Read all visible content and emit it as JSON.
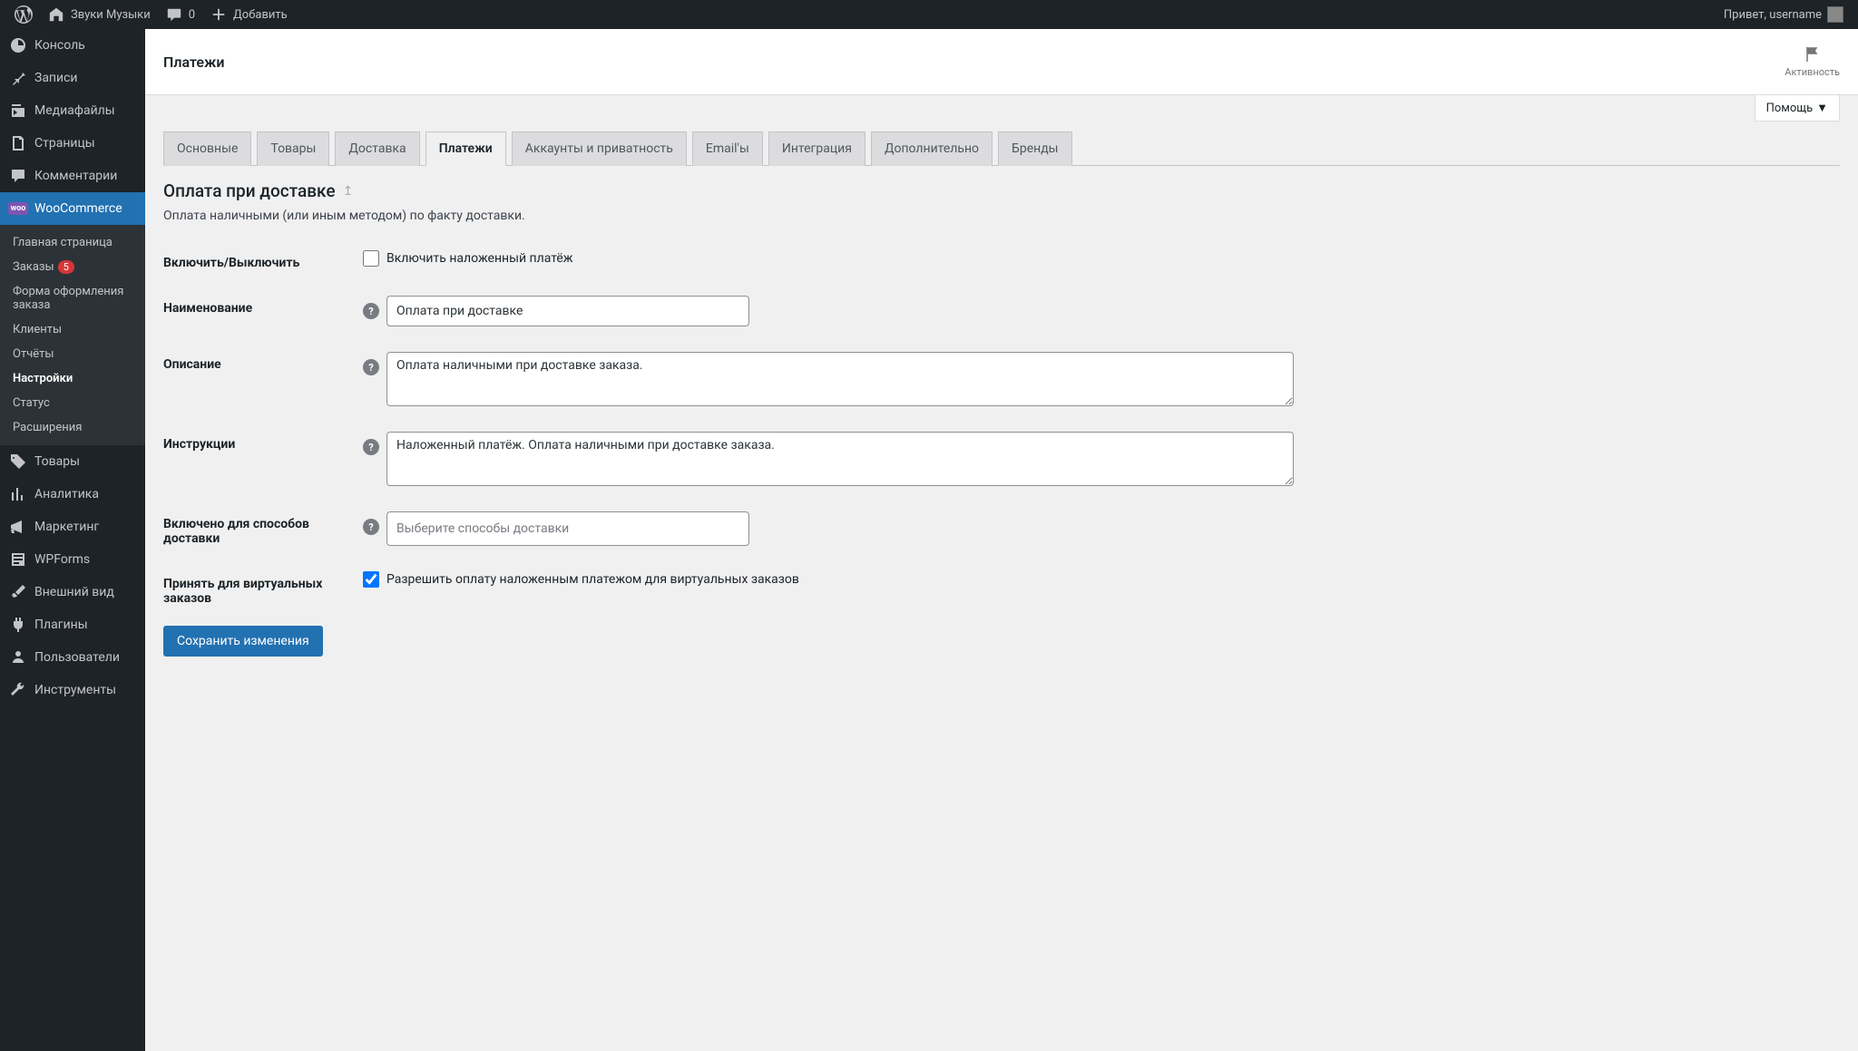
{
  "adminBar": {
    "siteName": "Звуки Музыки",
    "commentCount": "0",
    "addNew": "Добавить",
    "greeting": "Привет, username"
  },
  "sidebar": {
    "dashboard": "Консоль",
    "posts": "Записи",
    "media": "Медиафайлы",
    "pages": "Страницы",
    "comments": "Комментарии",
    "woocommerce": "WooCommerce",
    "wooSubmenu": {
      "home": "Главная страница",
      "orders": "Заказы",
      "ordersBadge": "5",
      "checkout": "Форма оформления заказа",
      "customers": "Клиенты",
      "reports": "Отчёты",
      "settings": "Настройки",
      "status": "Статус",
      "extensions": "Расширения"
    },
    "products": "Товары",
    "analytics": "Аналитика",
    "marketing": "Маркетинг",
    "wpforms": "WPForms",
    "appearance": "Внешний вид",
    "plugins": "Плагины",
    "users": "Пользователи",
    "tools": "Инструменты"
  },
  "header": {
    "title": "Платежи",
    "activity": "Активность",
    "help": "Помощь"
  },
  "tabs": [
    {
      "label": "Основные",
      "active": false
    },
    {
      "label": "Товары",
      "active": false
    },
    {
      "label": "Доставка",
      "active": false
    },
    {
      "label": "Платежи",
      "active": true
    },
    {
      "label": "Аккаунты и приватность",
      "active": false
    },
    {
      "label": "Email'ы",
      "active": false
    },
    {
      "label": "Интеграция",
      "active": false
    },
    {
      "label": "Дополнительно",
      "active": false
    },
    {
      "label": "Бренды",
      "active": false
    }
  ],
  "section": {
    "title": "Оплата при доставке",
    "description": "Оплата наличными (или иным методом) по факту доставки."
  },
  "form": {
    "enableLabel": "Включить/Выключить",
    "enableCheckbox": "Включить наложенный платёж",
    "titleLabel": "Наименование",
    "titleValue": "Оплата при доставке",
    "descLabel": "Описание",
    "descValue": "Оплата наличными при доставке заказа.",
    "instrLabel": "Инструкции",
    "instrValue": "Наложенный платёж. Оплата наличными при доставке заказа.",
    "shippingLabel": "Включено для способов доставки",
    "shippingPlaceholder": "Выберите способы доставки",
    "virtualLabel": "Принять для виртуальных заказов",
    "virtualCheckbox": "Разрешить оплату наложенным платежом для виртуальных заказов",
    "saveButton": "Сохранить изменения"
  }
}
